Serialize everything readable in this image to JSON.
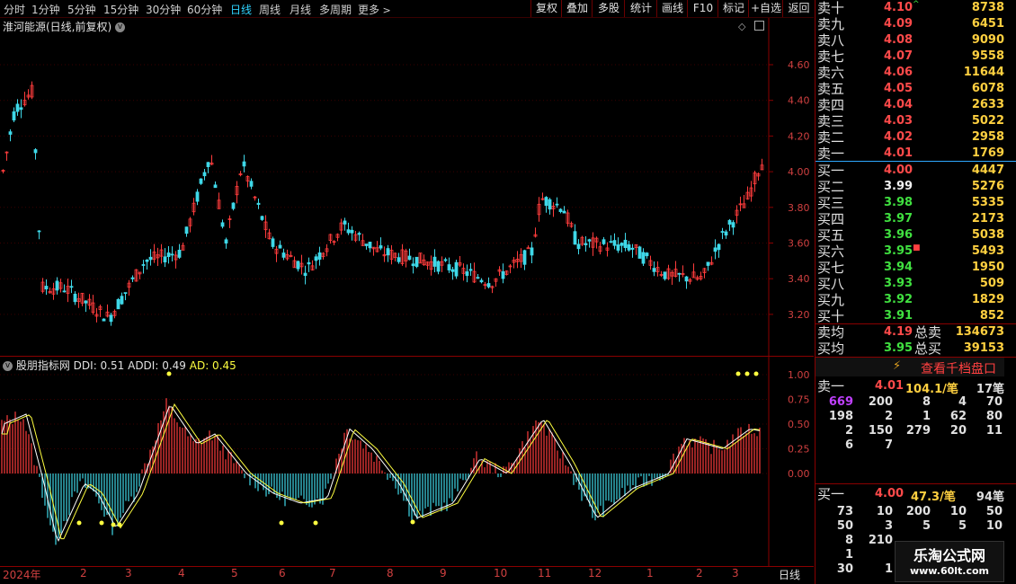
{
  "toolbar": {
    "periods": [
      "分时",
      "1分钟",
      "5分钟",
      "15分钟",
      "30分钟",
      "60分钟",
      "日线",
      "周线",
      "月线",
      "多周期",
      "更多"
    ],
    "active_period": "日线",
    "right_buttons": [
      "复权",
      "叠加",
      "多股",
      "统计",
      "画线",
      "F10",
      "标记",
      "+自选",
      "返回"
    ]
  },
  "main_chart": {
    "title": "淮河能源(日线,前复权)",
    "y_ticks": [
      "4.60",
      "4.40",
      "4.20",
      "4.00",
      "3.80",
      "3.60",
      "3.40",
      "3.20"
    ]
  },
  "indicator": {
    "name": "股朋指标网",
    "ddi": "DDI: 0.51",
    "addi": "ADDI: 0.49",
    "ad": "AD: 0.45",
    "y_ticks": [
      "1.00",
      "0.75",
      "0.50",
      "0.25",
      "0.00"
    ]
  },
  "x_axis": {
    "labels": [
      "2024年",
      "2",
      "3",
      "4",
      "5",
      "6",
      "7",
      "8",
      "9",
      "10",
      "11",
      "12",
      "1",
      "2",
      "3"
    ],
    "period_tag": "日线"
  },
  "order_book": {
    "asks": [
      {
        "label": "卖十",
        "price": "4.10",
        "volume": "8738",
        "mark": "^"
      },
      {
        "label": "卖九",
        "price": "4.09",
        "volume": "6451"
      },
      {
        "label": "卖八",
        "price": "4.08",
        "volume": "9090"
      },
      {
        "label": "卖七",
        "price": "4.07",
        "volume": "9558"
      },
      {
        "label": "卖六",
        "price": "4.06",
        "volume": "11644"
      },
      {
        "label": "卖五",
        "price": "4.05",
        "volume": "6078"
      },
      {
        "label": "卖四",
        "price": "4.04",
        "volume": "2633"
      },
      {
        "label": "卖三",
        "price": "4.03",
        "volume": "5022"
      },
      {
        "label": "卖二",
        "price": "4.02",
        "volume": "2958"
      },
      {
        "label": "卖一",
        "price": "4.01",
        "volume": "1769"
      }
    ],
    "bids": [
      {
        "label": "买一",
        "price": "4.00",
        "volume": "4447",
        "cls": "up"
      },
      {
        "label": "买二",
        "price": "3.99",
        "volume": "5276",
        "cls": "fl"
      },
      {
        "label": "买三",
        "price": "3.98",
        "volume": "5335",
        "cls": "dn"
      },
      {
        "label": "买四",
        "price": "3.97",
        "volume": "2173",
        "cls": "dn"
      },
      {
        "label": "买五",
        "price": "3.96",
        "volume": "5038",
        "cls": "dn"
      },
      {
        "label": "买六",
        "price": "3.95",
        "volume": "5493",
        "cls": "dn",
        "mark": "■"
      },
      {
        "label": "买七",
        "price": "3.94",
        "volume": "1950",
        "cls": "dn"
      },
      {
        "label": "买八",
        "price": "3.93",
        "volume": "509",
        "cls": "dn"
      },
      {
        "label": "买九",
        "price": "3.92",
        "volume": "1829",
        "cls": "dn"
      },
      {
        "label": "买十",
        "price": "3.91",
        "volume": "852",
        "cls": "dn"
      }
    ],
    "ask_avg": {
      "label": "卖均",
      "price": "4.19",
      "total_label": "总卖",
      "total": "134673"
    },
    "bid_avg": {
      "label": "买均",
      "price": "3.95",
      "total_label": "总买",
      "total": "39153"
    },
    "view_button": "查看千档盘口",
    "sell1_detail": {
      "label": "卖一",
      "price": "4.01",
      "avg": "104.1/笔",
      "count": "17笔"
    },
    "sell1_queue": [
      [
        "669",
        "200",
        "8",
        "4",
        "70"
      ],
      [
        "198",
        "2",
        "1",
        "62",
        "80"
      ],
      [
        "2",
        "150",
        "279",
        "20",
        "11"
      ],
      [
        "6",
        "7",
        "",
        "",
        ""
      ]
    ],
    "buy1_detail": {
      "label": "买一",
      "price": "4.00",
      "avg": "47.3/笔",
      "count": "94笔"
    },
    "buy1_queue": [
      [
        "73",
        "10",
        "200",
        "10",
        "50"
      ],
      [
        "50",
        "3",
        "5",
        "5",
        "10"
      ],
      [
        "8",
        "210",
        "",
        "",
        ""
      ],
      [
        "1",
        "",
        "",
        "",
        ""
      ],
      [
        "30",
        "1",
        "",
        "",
        ""
      ]
    ]
  },
  "watermark": {
    "title": "乐淘公式网",
    "url": "www.60lt.com"
  }
}
